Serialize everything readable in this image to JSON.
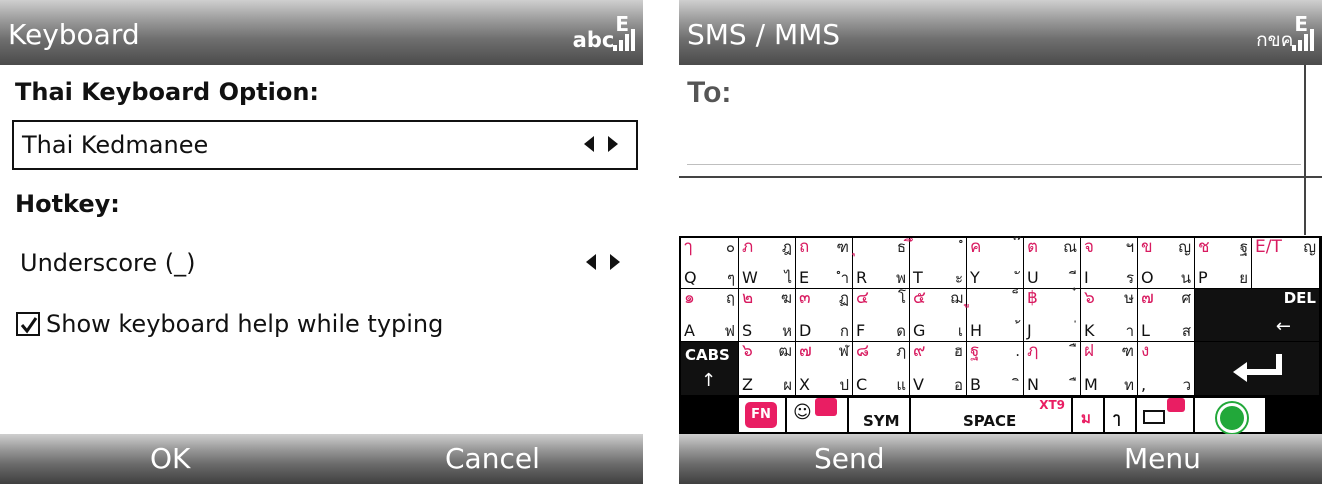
{
  "left": {
    "title": "Keyboard",
    "status_label": "abc",
    "status_network": "E",
    "thai_heading": "Thai Keyboard Option:",
    "thai_value": "Thai Kedmanee",
    "hotkey_heading": "Hotkey:",
    "hotkey_value": "Underscore (_)",
    "checkbox_label": "Show keyboard help while typing",
    "checkbox_checked": true,
    "softkey_left": "OK",
    "softkey_right": "Cancel"
  },
  "right": {
    "title": "SMS / MMS",
    "status_label": "กขค",
    "status_network": "E",
    "to_label": "To:",
    "softkey_left": "Send",
    "softkey_right": "Menu",
    "keyboard": {
      "row1": [
        {
          "top": "ๅ",
          "topr": "๐",
          "bot": "Q",
          "botr": "ๆ"
        },
        {
          "top": "ภ",
          "topr": "ฎ",
          "bot": "W",
          "botr": "ไ"
        },
        {
          "top": "ถ",
          "topr": "ฑ",
          "bot": "E",
          "botr": "ำ"
        },
        {
          "top": "ุ",
          "topr": "ธ",
          "bot": "R",
          "botr": "พ"
        },
        {
          "top": "ึ",
          "topr": "ํ",
          "bot": "T",
          "botr": "ะ"
        },
        {
          "top": "ค",
          "topr": "๊",
          "bot": "Y",
          "botr": "ั"
        },
        {
          "top": "ต",
          "topr": "ณ",
          "bot": "U",
          "botr": "ี"
        },
        {
          "top": "จ",
          "topr": "ฯ",
          "bot": "I",
          "botr": "ร"
        },
        {
          "top": "ข",
          "topr": "ญ",
          "bot": "O",
          "botr": "น"
        },
        {
          "top": "ช",
          "topr": "ฐ",
          "bot": "P",
          "botr": "ย"
        }
      ],
      "row2": [
        {
          "top": "๑",
          "topr": "ฤ",
          "bot": "A",
          "botr": "ฟ"
        },
        {
          "top": "๒",
          "topr": "ฆ",
          "bot": "S",
          "botr": "ห"
        },
        {
          "top": "๓",
          "topr": "ฏ",
          "bot": "D",
          "botr": "ก"
        },
        {
          "top": "๔",
          "topr": "โ",
          "bot": "F",
          "botr": "ด"
        },
        {
          "top": "๕",
          "topr": "ฌ",
          "bot": "G",
          "botr": "เ"
        },
        {
          "top": "ู",
          "topr": "็",
          "bot": "H",
          "botr": "้"
        },
        {
          "top": "฿",
          "topr": "๋",
          "bot": "J",
          "botr": "่"
        },
        {
          "top": "๖",
          "topr": "ษ",
          "bot": "K",
          "botr": "า"
        },
        {
          "top": "๗",
          "topr": "ศ",
          "bot": "L",
          "botr": "ส"
        }
      ],
      "row3": [
        {
          "top": "๖",
          "topr": "ฒ",
          "bot": "Z",
          "botr": "ผ"
        },
        {
          "top": "๗",
          "topr": "ฬ",
          "bot": "X",
          "botr": "ป"
        },
        {
          "top": "๘",
          "topr": "ฦ",
          "bot": "C",
          "botr": "แ"
        },
        {
          "top": "๙",
          "topr": "ฮ",
          "bot": "V",
          "botr": "อ"
        },
        {
          "top": "ฐ",
          "topr": ".",
          "bot": "B",
          "botr": "ิ"
        },
        {
          "top": "ฦ",
          "topr": "ื",
          "bot": "N",
          "botr": "ื"
        },
        {
          "top": "ฝ",
          "topr": "ฑ",
          "bot": "M",
          "botr": "ท"
        },
        {
          "top": "ง",
          "topr": "",
          "bot": ",",
          "botr": "ว"
        }
      ],
      "labels": {
        "e_t": "E/T",
        "e_t_thai": "ญ",
        "del": "DEL",
        "cabs": "CABS",
        "fn": "FN",
        "sym": "SYM",
        "space": "SPACE",
        "xt9": "XT9",
        "thai_key1": "ม",
        "thai_key2": "ๅ"
      }
    }
  }
}
